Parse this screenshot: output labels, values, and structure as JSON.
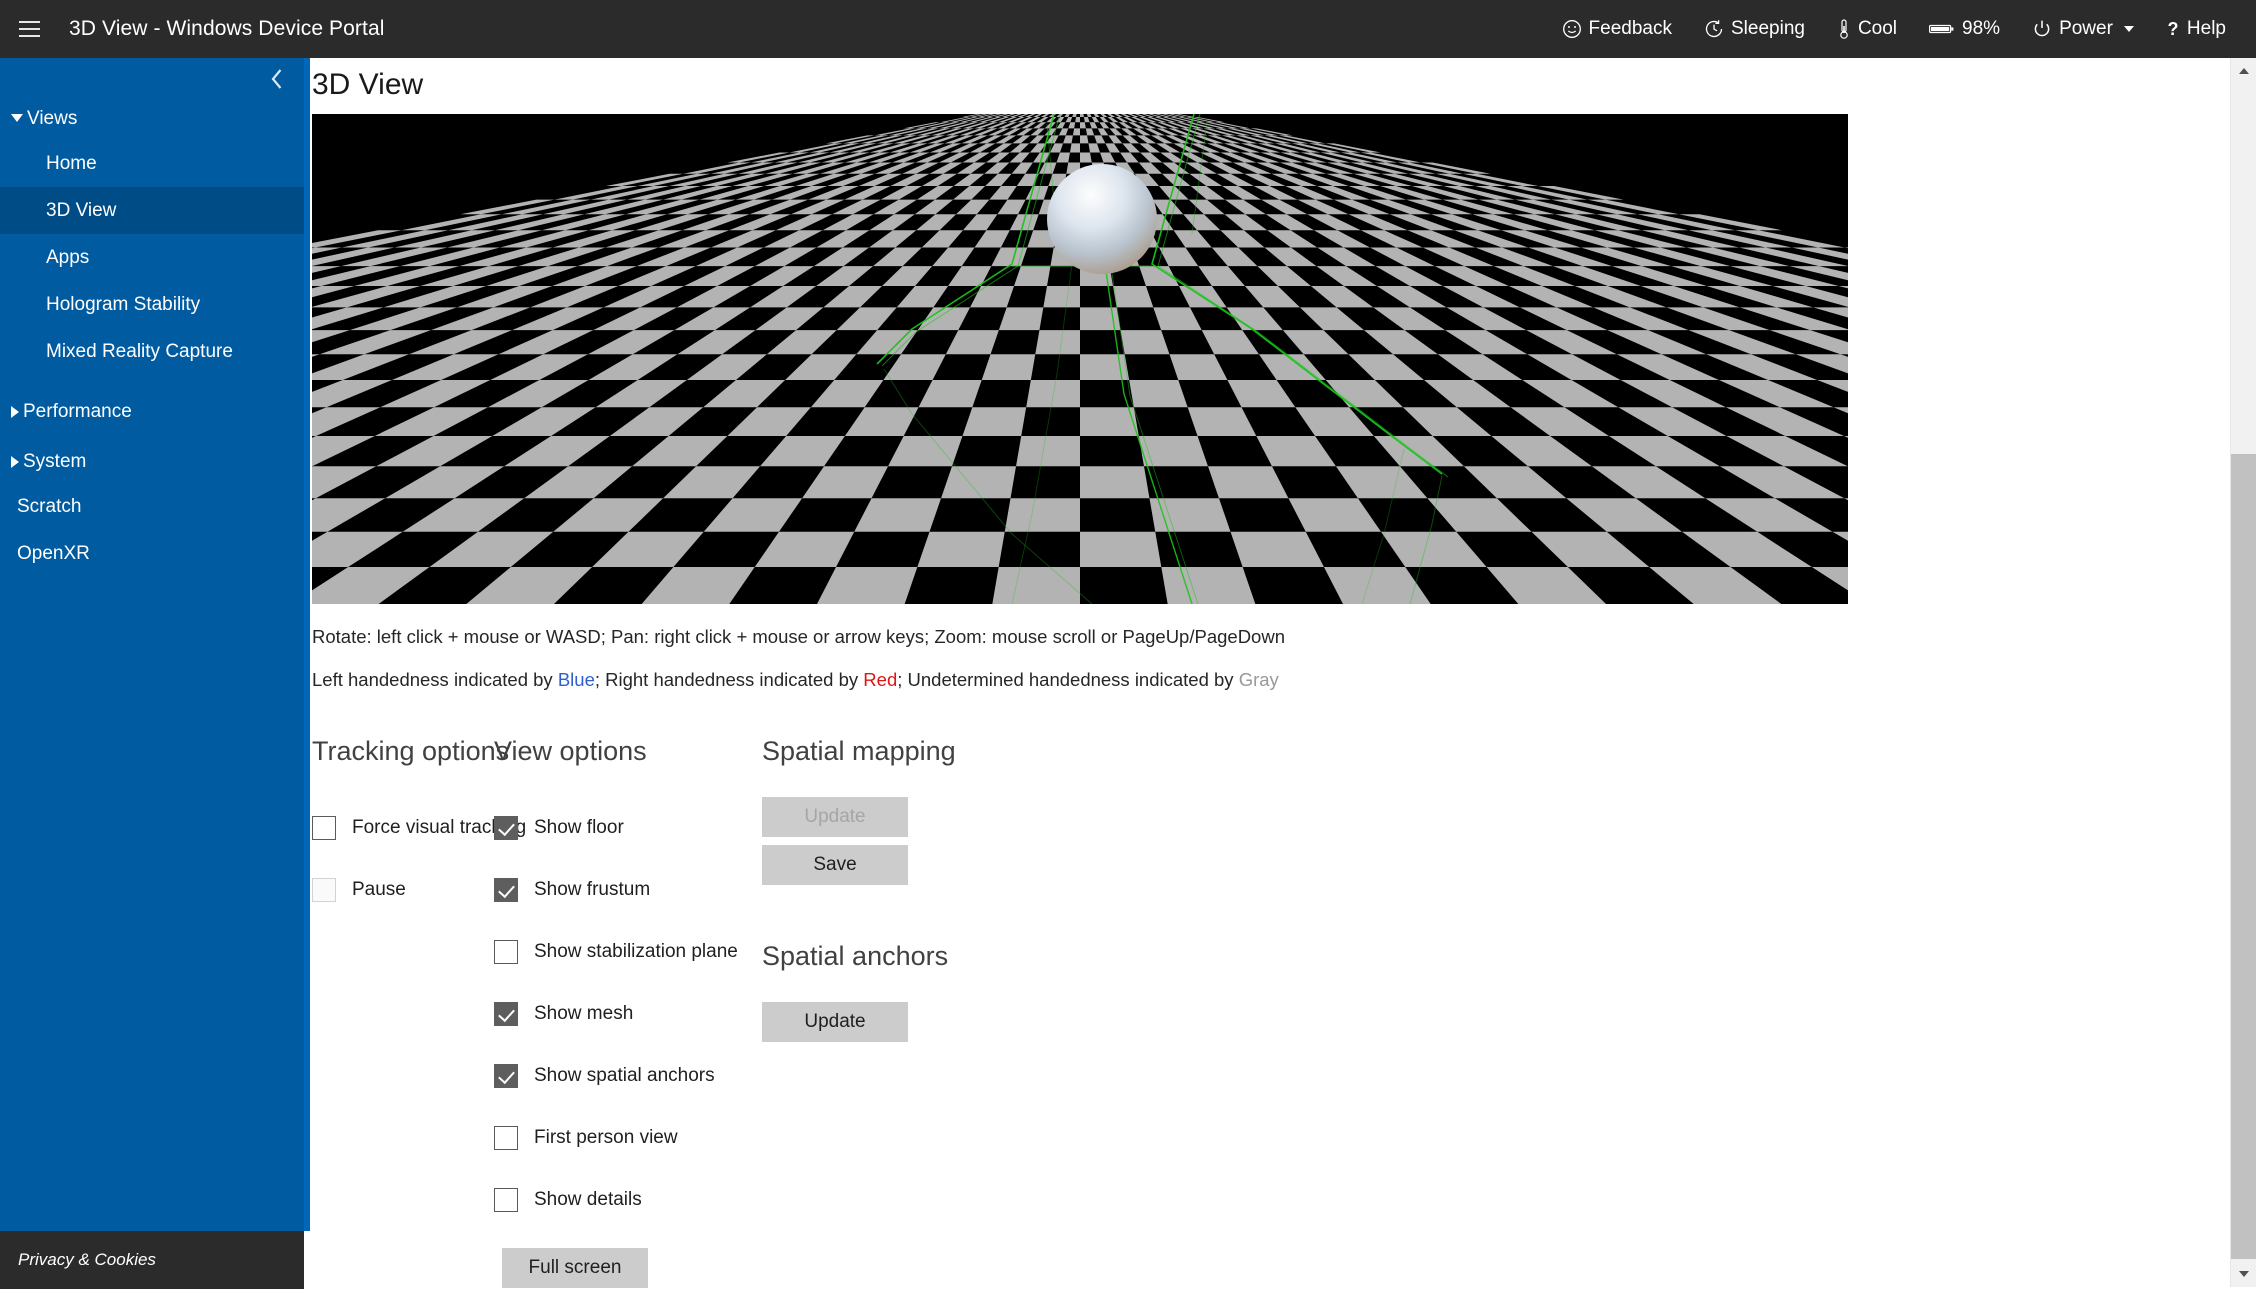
{
  "topbar": {
    "menu_icon": "hamburger-icon",
    "title": "3D View - Windows Device Portal",
    "items": [
      {
        "icon": "smiley-face-icon",
        "glyph": "☺",
        "label": "Feedback"
      },
      {
        "icon": "clock-sleep-icon",
        "glyph": "↺",
        "label": "Sleeping"
      },
      {
        "icon": "thermometer-icon",
        "glyph": "¡",
        "label": "Cool"
      },
      {
        "icon": "battery-icon",
        "glyph": "▬",
        "label": "98%"
      },
      {
        "icon": "power-icon",
        "glyph": "⏻",
        "label": "Power",
        "has_caret": true
      },
      {
        "icon": "question-mark-icon",
        "glyph": "?",
        "label": "Help"
      }
    ]
  },
  "sidebar": {
    "collapse_icon": "chevron-left-icon",
    "accent_color": "#0067b8",
    "background_color": "#005ba1",
    "selected_color": "#004c86",
    "nav": [
      {
        "label": "Views",
        "type": "group",
        "expanded": true
      },
      {
        "label": "Home",
        "type": "item",
        "selected": false
      },
      {
        "label": "3D View",
        "type": "item",
        "selected": true
      },
      {
        "label": "Apps",
        "type": "item",
        "selected": false
      },
      {
        "label": "Hologram Stability",
        "type": "item",
        "selected": false
      },
      {
        "label": "Mixed Reality Capture",
        "type": "item",
        "selected": false
      },
      {
        "label": "Performance",
        "type": "group",
        "expanded": false
      },
      {
        "label": "System",
        "type": "group",
        "expanded": false
      },
      {
        "label": "Scratch",
        "type": "item",
        "selected": false
      },
      {
        "label": "OpenXR",
        "type": "item",
        "selected": false
      }
    ],
    "footer_label": "Privacy & Cookies"
  },
  "main": {
    "page_title": "3D View",
    "viewport": {
      "name": "3d-scene-viewport",
      "scene": "checkerboard floor with hologram sphere and green frustum mesh lines",
      "floor_light": "#b3b3b3",
      "floor_dark": "#000000",
      "mesh_color": "#19c419"
    },
    "hints": {
      "controls": "Rotate: left click + mouse or WASD; Pan: right click + mouse or arrow keys; Zoom: mouse scroll or PageUp/PageDown",
      "handedness": {
        "part1": "Left handedness indicated by ",
        "blue": "Blue",
        "part2": "; Right handedness indicated by ",
        "red": "Red",
        "part3": "; Undetermined handedness indicated by ",
        "gray": "Gray",
        "blue_color": "#2f5fd0",
        "red_color": "#e01414",
        "gray_color": "#999999"
      }
    },
    "tracking_options": {
      "heading": "Tracking options",
      "checkboxes": [
        {
          "label": "Force visual tracking",
          "checked": false,
          "disabled": false
        },
        {
          "label": "Pause",
          "checked": false,
          "disabled": true
        }
      ]
    },
    "view_options": {
      "heading": "View options",
      "checkboxes": [
        {
          "label": "Show floor",
          "checked": true,
          "disabled": false
        },
        {
          "label": "Show frustum",
          "checked": true,
          "disabled": false
        },
        {
          "label": "Show stabilization plane",
          "checked": false,
          "disabled": false
        },
        {
          "label": "Show mesh",
          "checked": true,
          "disabled": false
        },
        {
          "label": "Show spatial anchors",
          "checked": true,
          "disabled": false
        },
        {
          "label": "First person view",
          "checked": false,
          "disabled": false
        },
        {
          "label": "Show details",
          "checked": false,
          "disabled": false
        }
      ],
      "fullscreen_label": "Full screen"
    },
    "spatial_mapping": {
      "heading": "Spatial mapping",
      "update_label": "Update",
      "update_disabled": true,
      "save_label": "Save"
    },
    "spatial_anchors": {
      "heading": "Spatial anchors",
      "update_label": "Update"
    }
  },
  "scrollbar": {
    "up_icon": "scroll-up-arrow-icon",
    "down_icon": "scroll-down-arrow-icon"
  }
}
